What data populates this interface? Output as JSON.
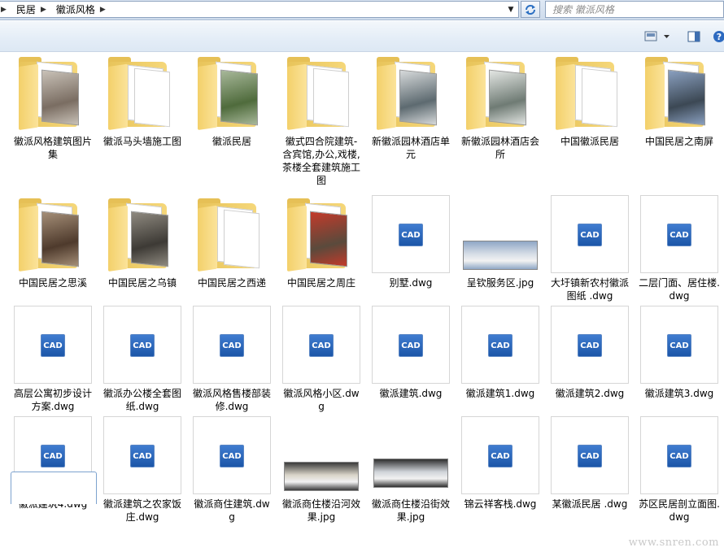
{
  "address": {
    "crumbs": [
      "民居",
      "徽派风格"
    ]
  },
  "search": {
    "placeholder": "搜索 徽派风格"
  },
  "toolbar": {
    "view_icon": "view-icon",
    "preview_icon": "preview-pane-icon",
    "help_icon": "help-icon"
  },
  "items": [
    {
      "name": "徽派风格建筑图片集",
      "type": "folder",
      "content": "photo",
      "c1": "#7a6d62",
      "c2": "#c9c2b8"
    },
    {
      "name": "徽派马头墙施工图",
      "type": "folder",
      "content": "paper"
    },
    {
      "name": "徽派民居",
      "type": "folder",
      "content": "photo",
      "c1": "#4f6b3c",
      "c2": "#a8b89a"
    },
    {
      "name": "徽式四合院建筑-含宾馆,办公,戏楼,茶楼全套建筑施工图",
      "type": "folder",
      "content": "paper"
    },
    {
      "name": "新徽派园林酒店单元",
      "type": "folder",
      "content": "photo",
      "c1": "#5d6a70",
      "c2": "#d7dadb"
    },
    {
      "name": "新徽派园林酒店会所",
      "type": "folder",
      "content": "photo",
      "c1": "#6f7b74",
      "c2": "#e3e6e3"
    },
    {
      "name": "中国徽派民居",
      "type": "folder",
      "content": "paper"
    },
    {
      "name": "中国民居之南屏",
      "type": "folder",
      "content": "photo",
      "c1": "#3c4854",
      "c2": "#8aa0c0"
    },
    {
      "name": "中国民居之思溪",
      "type": "folder",
      "content": "photo",
      "c1": "#4e3a2c",
      "c2": "#a58f78"
    },
    {
      "name": "中国民居之乌镇",
      "type": "folder",
      "content": "photo",
      "c1": "#3d3a35",
      "c2": "#8f8a80"
    },
    {
      "name": "中国民居之西递",
      "type": "folder",
      "content": "paper"
    },
    {
      "name": "中国民居之周庄",
      "type": "folder",
      "content": "photo",
      "c1": "#5a4a3c",
      "c2": "#c43a2a"
    },
    {
      "name": "别墅.dwg",
      "type": "cad"
    },
    {
      "name": "呈钦服务区.jpg",
      "type": "jpg",
      "c1": "#8fa7c6",
      "c2": "#d6dde6",
      "h": 36,
      "t": 56
    },
    {
      "name": "大圩镇新农村徽派图纸 .dwg",
      "type": "cad"
    },
    {
      "name": "二层门面、居住楼.dwg",
      "type": "cad"
    },
    {
      "name": "高层公寓初步设计方案.dwg",
      "type": "cad"
    },
    {
      "name": "徽派办公楼全套图纸.dwg",
      "type": "cad"
    },
    {
      "name": "徽派风格售楼部装修.dwg",
      "type": "cad"
    },
    {
      "name": "徽派风格小区.dwg",
      "type": "cad"
    },
    {
      "name": "徽派建筑.dwg",
      "type": "cad"
    },
    {
      "name": "徽派建筑1.dwg",
      "type": "cad"
    },
    {
      "name": "徽派建筑2.dwg",
      "type": "cad"
    },
    {
      "name": "徽派建筑3.dwg",
      "type": "cad"
    },
    {
      "name": "徽派建筑4.dwg",
      "type": "cad"
    },
    {
      "name": "徽派建筑之农家饭庄.dwg",
      "type": "cad"
    },
    {
      "name": "徽派商住建筑.dwg",
      "type": "cad"
    },
    {
      "name": "徽派商住楼沿河效果.jpg",
      "type": "jpg",
      "c1": "#3a3a3a",
      "c2": "#d9d4c8",
      "h": 36,
      "t": 56
    },
    {
      "name": "徽派商住楼沿街效果.jpg",
      "type": "jpg",
      "c1": "#2f2f2f",
      "c2": "#cfd3d8",
      "h": 36,
      "t": 52
    },
    {
      "name": "锦云祥客栈.dwg",
      "type": "cad"
    },
    {
      "name": "某徽派民居 .dwg",
      "type": "cad"
    },
    {
      "name": "苏区民居剖立面图.dwg",
      "type": "cad"
    }
  ],
  "watermark": "www.snren.com",
  "cad_label": "CAD"
}
